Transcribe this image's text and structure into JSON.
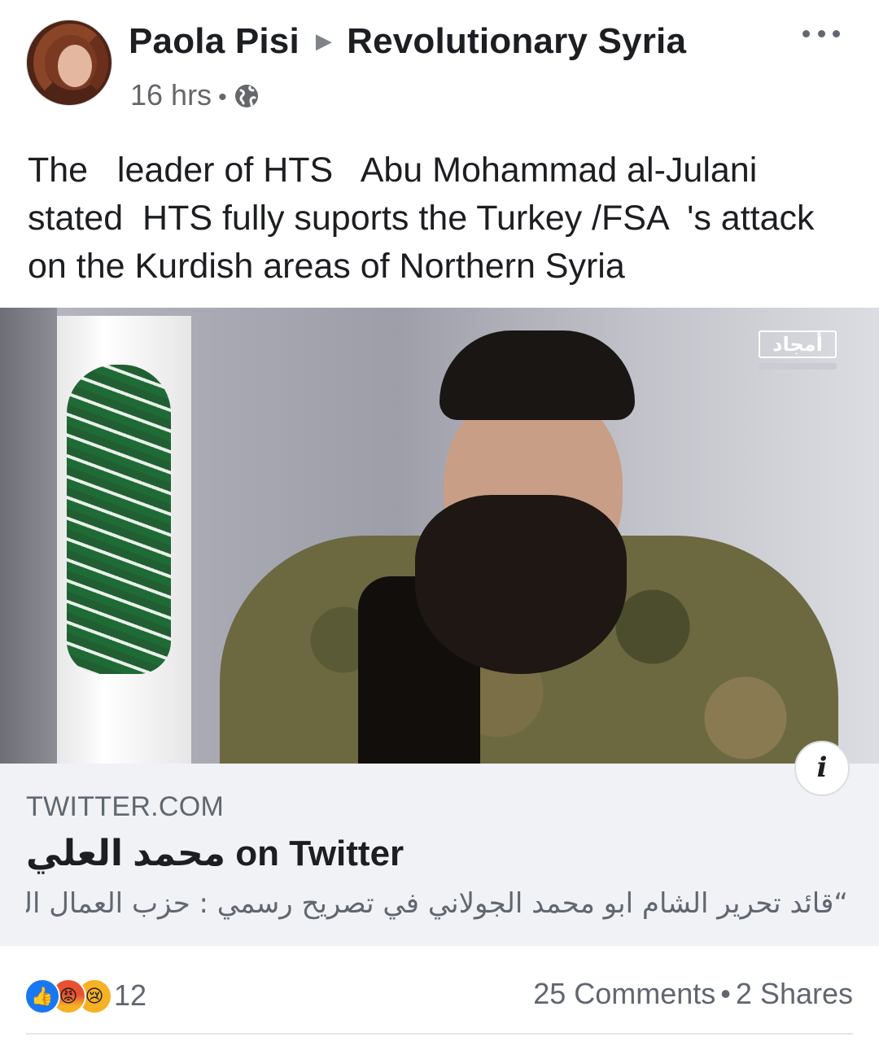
{
  "post": {
    "author": "Paola Pisi",
    "group": "Revolutionary Syria",
    "time": "16 hrs",
    "separator": "•",
    "privacy_icon": "globe-icon",
    "text": "The   leader of HTS   Abu Mohammad al-Julani stated  HTS fully suports the Turkey /FSA  's attack on the Kurdish areas of Northern Syria"
  },
  "media": {
    "channel_logo": "أمجاد"
  },
  "link": {
    "domain": "TWITTER.COM",
    "title": "محمد العلي on Twitter",
    "description": "“قائد تحرير الشام ابو محمد الجولاني في تصريح رسمي : حزب العمال الك..."
  },
  "footer": {
    "reaction_icons": [
      "like-icon",
      "angry-icon",
      "sad-icon"
    ],
    "reaction_count": "12",
    "comments": "25 Comments",
    "separator": "•",
    "shares": "2 Shares"
  },
  "colors": {
    "text": "#1c1e21",
    "secondary": "#606770",
    "link_bg": "#f0f2f5",
    "like_blue": "#1877f2"
  }
}
